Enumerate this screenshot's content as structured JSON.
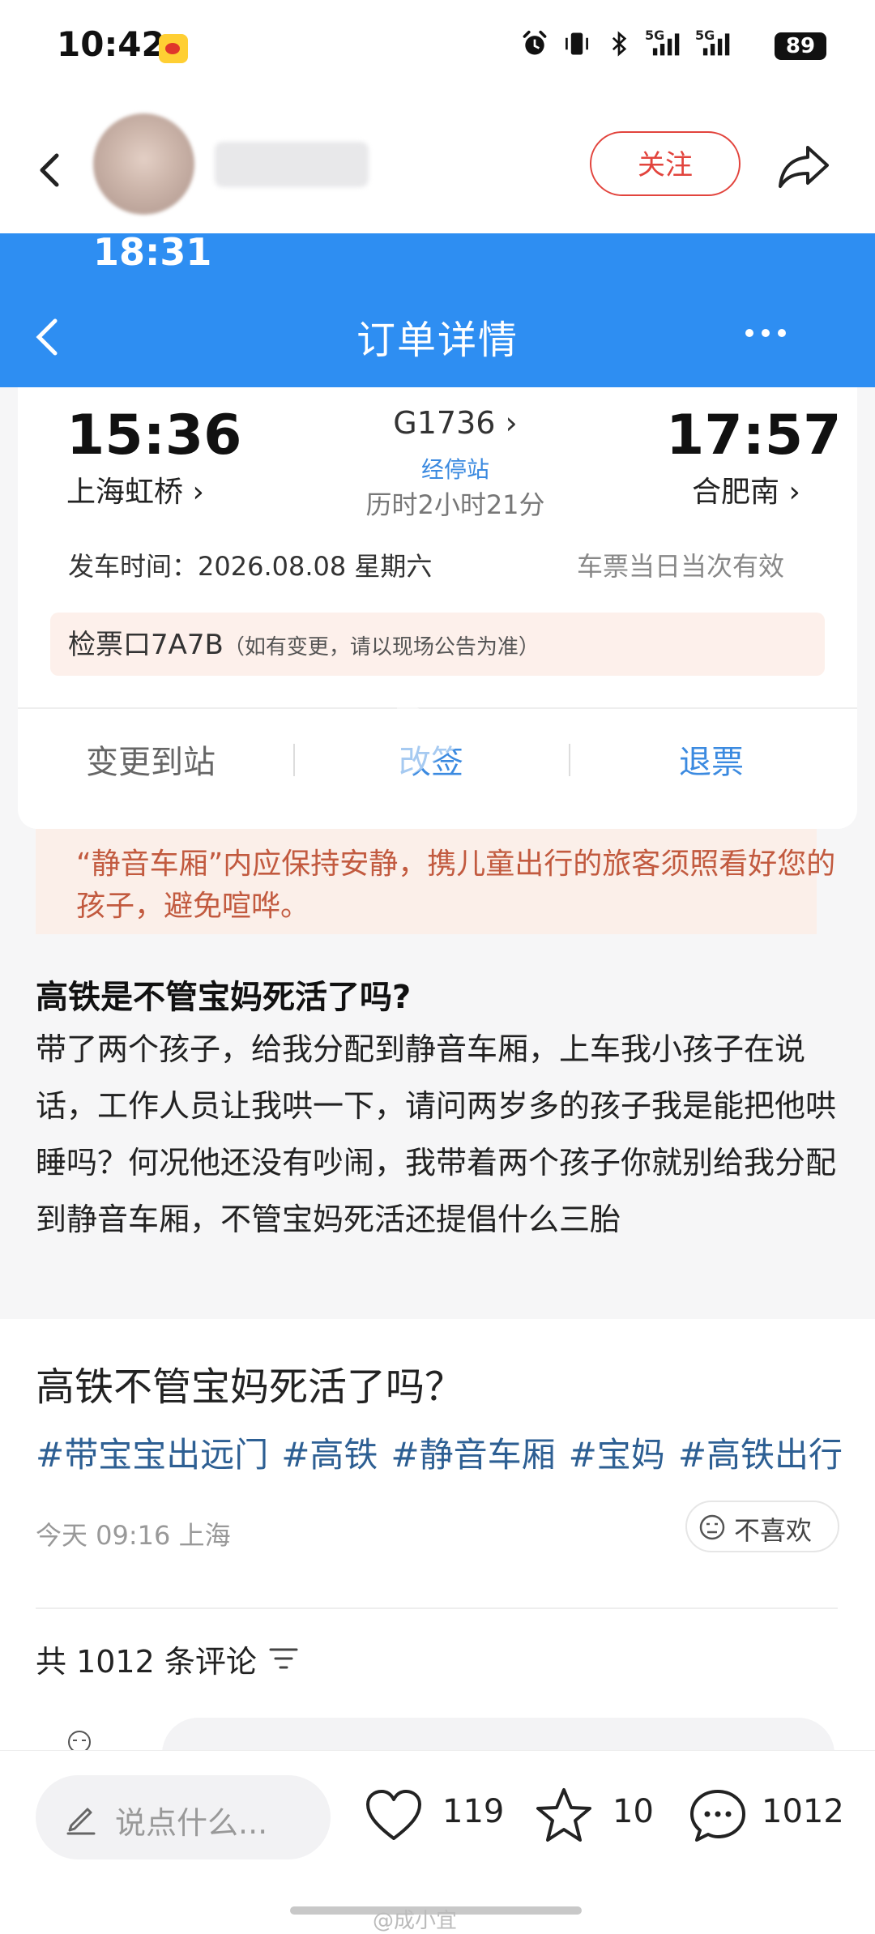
{
  "status_bar": {
    "time": "10:42",
    "battery": "89",
    "signal_1": "5G",
    "signal_2": "5G"
  },
  "header": {
    "follow_label": "关注"
  },
  "embedded": {
    "status_time": "18:31",
    "nav_title": "订单详情",
    "departure_time": "15:36",
    "departure_station": "上海虹桥 ›",
    "arrival_time": "17:57",
    "arrival_station": "合肥南 ›",
    "train_number": "G1736 ›",
    "via_label": "经停站",
    "duration": "历时2小时21分",
    "depart_label": "发车时间：2026.08.08 星期六",
    "valid_note": "车票当日当次有效",
    "gate": "检票口7A7B",
    "gate_note": "（如有变更，请以现场公告为准）",
    "action_change": "变更到站",
    "action_resign": "改签",
    "action_refund": "退票",
    "notice": "“静音车厢”内应保持安静，携儿童出行的旅客须照看好您的孩子，避免喧哗。",
    "post_heading": "高铁是不管宝妈死活了吗?",
    "post_body": "带了两个孩子，给我分配到静音车厢，上车我小孩子在说话，工作人员让我哄一下，请问两岁多的孩子我是能把他哄睡吗？何况他还没有吵闹，我带着两个孩子你就别给我分配到静音车厢，不管宝妈死活还提倡什么三胎"
  },
  "post": {
    "title": "高铁不管宝妈死活了吗？",
    "hashtags": [
      "#带宝宝出远门",
      "#高铁",
      "#静音车厢",
      "#宝妈",
      "#高铁出行"
    ],
    "meta": "今天 09:16 上海",
    "dislike_label": "不喜欢",
    "comments_count": "共 1012 条评论"
  },
  "bottom_bar": {
    "input_placeholder": "说点什么...",
    "likes": "119",
    "favorites": "10",
    "comments": "1012"
  },
  "watermark": "@成小宜",
  "colors": {
    "accent_red": "#e2443d",
    "railway_blue": "#2e8ef2",
    "hashtag_blue": "#2d5f93"
  }
}
